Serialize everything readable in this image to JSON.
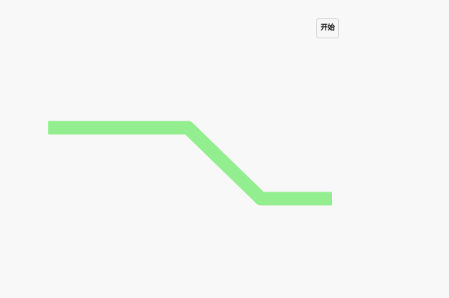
{
  "controls": {
    "start_label": "开始"
  },
  "colors": {
    "background": "#f8f8f8",
    "path": "#93ee8f"
  }
}
